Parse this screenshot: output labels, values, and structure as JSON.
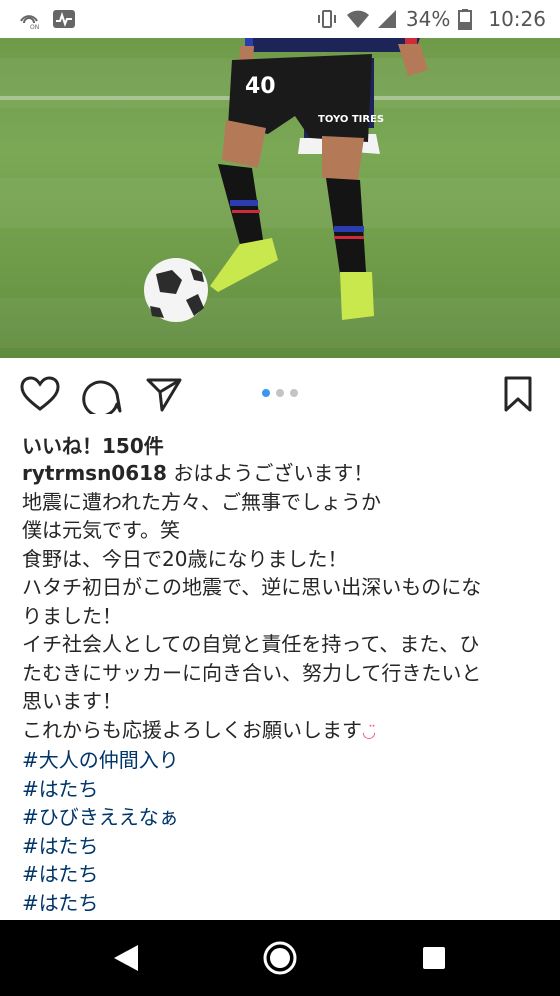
{
  "status_bar": {
    "battery_percent": "34%",
    "time": "10:26",
    "left_icons": [
      "wifi-calling-icon",
      "activity-icon"
    ],
    "right_icons": [
      "vibrate-icon",
      "wifi-icon",
      "signal-icon",
      "battery-icon"
    ]
  },
  "post": {
    "carousel": {
      "count": 3,
      "active_index": 0
    },
    "likes_text": "いいね！150件",
    "username": "rytrmsn0618",
    "caption_first": "おはようございます！",
    "caption_lines": [
      "地震に遭われた方々、ご無事でしょうか",
      "僕は元気です。笑",
      "食野は、今日で20歳になりました！",
      "ハタチ初日がこの地震で、逆に思い出深いものにな",
      "りました！",
      "イチ社会人としての自覚と責任を持って、また、ひ",
      "たむきにサッカーに向き合い、努力して行きたいと",
      "思います！",
      "これからも応援よろしくお願いします"
    ],
    "caption_emoji": "◡̈",
    "hashtags": [
      "#大人の仲間入り",
      "#はたち",
      "#ひびきええなぁ",
      "#はたち",
      "#はたち",
      "#はたち"
    ],
    "photo_jersey_number": "40",
    "photo_sponsor_text": "TOYO TIRES"
  },
  "colors": {
    "accent": "#3897f0",
    "hashtag": "#003569",
    "text": "#262626"
  }
}
